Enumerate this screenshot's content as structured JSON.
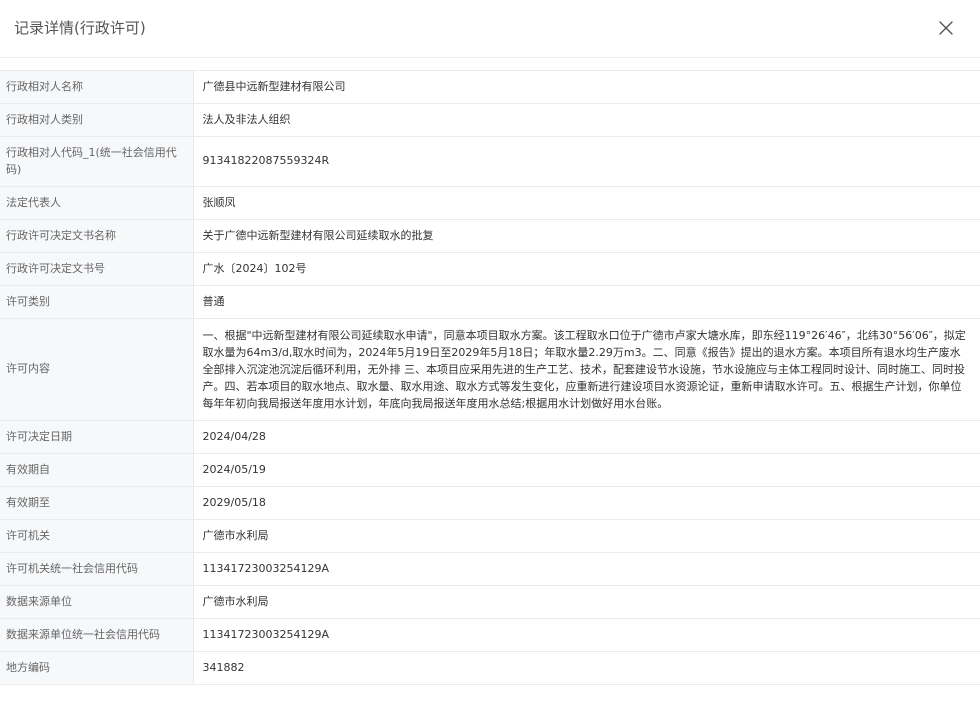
{
  "dialog": {
    "title": "记录详情(行政许可)"
  },
  "rows": [
    {
      "label": "行政相对人名称",
      "value": "广德县中远新型建材有限公司"
    },
    {
      "label": "行政相对人类别",
      "value": "法人及非法人组织"
    },
    {
      "label": "行政相对人代码_1(统一社会信用代码)",
      "value": "91341822087559324R"
    },
    {
      "label": "法定代表人",
      "value": "张顺凤"
    },
    {
      "label": "行政许可决定文书名称",
      "value": "关于广德中远新型建材有限公司延续取水的批复"
    },
    {
      "label": "行政许可决定文书号",
      "value": "广水〔2024〕102号"
    },
    {
      "label": "许可类别",
      "value": "普通"
    },
    {
      "label": "许可内容",
      "value": "一、根据\"中远新型建材有限公司延续取水申请\"，同意本项目取水方案。该工程取水口位于广德市卢家大塘水库，即东经119°26′46″，北纬30°56′06″，拟定取水量为64m3/d,取水时间为，2024年5月19日至2029年5月18日；年取水量2.29万m3。二、同意《报告》提出的退水方案。本项目所有退水均生产废水全部排入沉淀池沉淀后循环利用，无外排 三、本项目应采用先进的生产工艺、技术，配套建设节水设施，节水设施应与主体工程同时设计、同时施工、同时投产。四、若本项目的取水地点、取水量、取水用途、取水方式等发生变化，应重新进行建设项目水资源论证，重新申请取水许可。五、根据生产计划，你单位每年年初向我局报送年度用水计划，年底向我局报送年度用水总结;根据用水计划做好用水台账。"
    },
    {
      "label": "许可决定日期",
      "value": "2024/04/28"
    },
    {
      "label": "有效期自",
      "value": "2024/05/19"
    },
    {
      "label": "有效期至",
      "value": "2029/05/18"
    },
    {
      "label": "许可机关",
      "value": "广德市水利局"
    },
    {
      "label": "许可机关统一社会信用代码",
      "value": "11341723003254129A"
    },
    {
      "label": "数据来源单位",
      "value": "广德市水利局"
    },
    {
      "label": "数据来源单位统一社会信用代码",
      "value": "11341723003254129A"
    },
    {
      "label": "地方编码",
      "value": "341882"
    }
  ],
  "icons": {
    "close": "close-icon"
  },
  "colors": {
    "label_bg": "#f7f8fa",
    "border": "#ebebeb",
    "text": "#333333",
    "label_text": "#666666"
  }
}
